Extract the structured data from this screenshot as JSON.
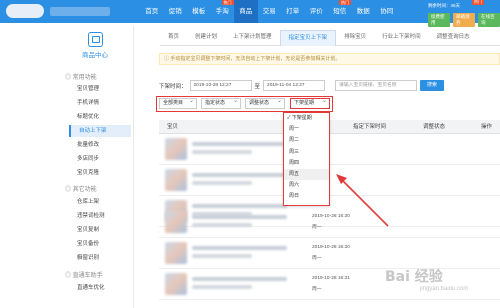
{
  "nav": {
    "items": [
      {
        "label": "首页",
        "badge": ""
      },
      {
        "label": "促销",
        "badge": ""
      },
      {
        "label": "模板",
        "badge": ""
      },
      {
        "label": "手淘",
        "badge": "热门"
      },
      {
        "label": "商品",
        "badge": ""
      },
      {
        "label": "交易",
        "badge": ""
      },
      {
        "label": "打单",
        "badge": ""
      },
      {
        "label": "评价",
        "badge": ""
      },
      {
        "label": "短信",
        "badge": "热门"
      },
      {
        "label": "数据",
        "badge": ""
      },
      {
        "label": "协同",
        "badge": ""
      }
    ],
    "active_index": 4
  },
  "account": {
    "line1": "剩余时间：46天",
    "badge": "热门",
    "renew": "续费使用",
    "coupon": "邮箱领券",
    "service": "在线咨询"
  },
  "sidebar": {
    "title": "商品中心",
    "group1": "常用功能",
    "group2": "其它功能",
    "group3": "直通车助手",
    "items": [
      "宝贝管理",
      "手机详情",
      "标题优化",
      "自动上下架",
      "批量修改",
      "多店同步",
      "宝贝克隆",
      "仓库上架",
      "违禁词检测",
      "宝贝复制",
      "宝贝备份",
      "橱窗识别",
      "直通车优化"
    ],
    "active_index": 3
  },
  "tabs": {
    "items": [
      "首页",
      "创建计划",
      "上下架计划管理",
      "指定宝贝上下架",
      "排除宝贝",
      "行业上下架时间",
      "调整查询日志"
    ],
    "active_index": 3
  },
  "notice": "手动指定宝贝调整下架时间，无法自动上下架计划，无论是否参加相关计划。",
  "filters": {
    "time_label": "下架时间：",
    "date_start": "2019-10-28 12:27",
    "to_label": "至",
    "date_end": "2019-11-04 12:27",
    "search_placeholder": "请输入宝贝链接、宝贝名称",
    "search_button": "搜索",
    "select_category": "全部类目",
    "select_assign": "指定状态",
    "select_adjust": "调整状态",
    "select_weekday": "下架星期"
  },
  "table": {
    "headers": [
      "宝贝",
      "指定下架时间",
      "调整状态",
      "操作"
    ],
    "rows": [
      {
        "time": "",
        "day": ""
      },
      {
        "time": "",
        "day": ""
      },
      {
        "time": "",
        "day": ""
      },
      {
        "time": "2019-10-28 16:30",
        "day": "周一"
      },
      {
        "time": "2019-10-28 16:30",
        "day": "周一"
      },
      {
        "time": "2019-10-28 16:31",
        "day": "周一"
      }
    ]
  },
  "dropdown": {
    "items": [
      "✓ 下架星期",
      "周一",
      "周二",
      "周三",
      "周四",
      "周五",
      "周六",
      "周日"
    ],
    "hover_index": 5
  },
  "watermark": {
    "text": "Bai 经验",
    "url": "jingyan.baidu.com"
  },
  "colors": {
    "topbar": "#2b8fe3",
    "accent": "#2b8fe3",
    "highlight": "#e23a3a"
  }
}
